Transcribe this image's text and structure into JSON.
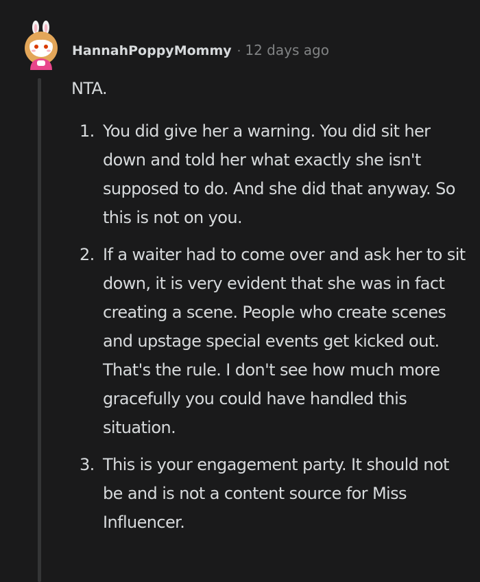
{
  "comment": {
    "author": "HannahPoppyMommy",
    "separator": "·",
    "timestamp": "12 days ago",
    "intro": "NTA.",
    "points": [
      {
        "number": "1.",
        "text": "You did give her a warning. You did sit her down and told her what exactly she isn't supposed to do. And she did that anyway. So this is not on you."
      },
      {
        "number": "2.",
        "text": "If a waiter had to come over and ask her to sit down, it is very evident that she was in fact creating a scene. People who create scenes and upstage special events get kicked out. That's the rule. I don't see how much more gracefully you could have handled this situation."
      },
      {
        "number": "3.",
        "text": "This is your engagement party. It should not be and is not a content source for Miss Influencer."
      }
    ]
  },
  "avatar": {
    "icon": "snoo-bunny-avatar-icon"
  },
  "colors": {
    "background": "#1a1a1b",
    "text": "#d7dadc",
    "meta": "#818384",
    "thread_line": "#343536"
  }
}
